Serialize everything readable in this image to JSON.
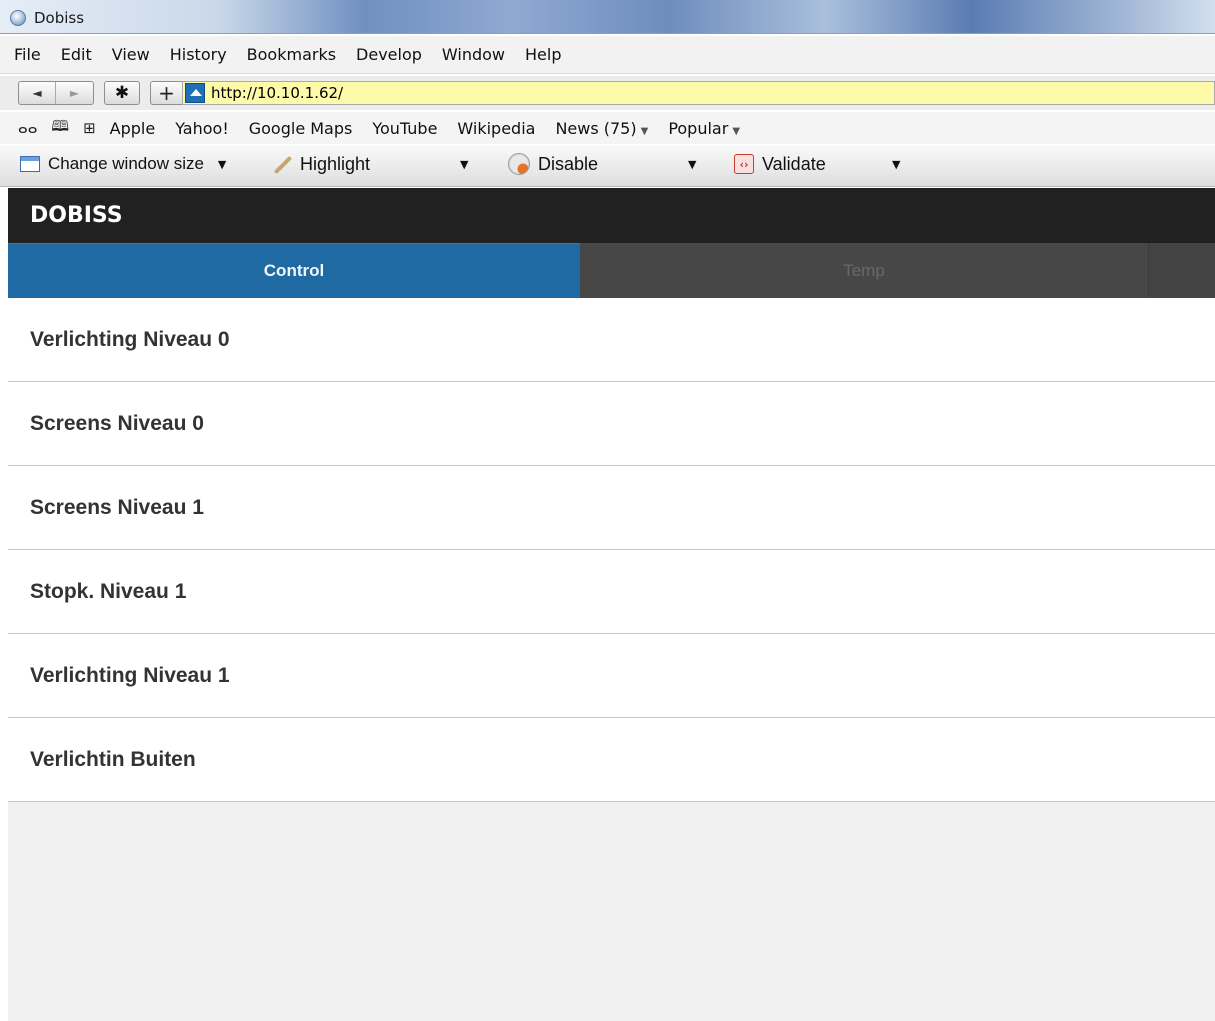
{
  "window": {
    "title": "Dobiss"
  },
  "menubar": {
    "items": [
      "File",
      "Edit",
      "View",
      "History",
      "Bookmarks",
      "Develop",
      "Window",
      "Help"
    ]
  },
  "nav": {
    "back_icon": "◄",
    "forward_icon": "►",
    "bug_icon": "✱",
    "add_icon": "+",
    "url": "http://10.10.1.62/"
  },
  "bookmarks": {
    "items": [
      "Apple",
      "Yahoo!",
      "Google Maps",
      "YouTube",
      "Wikipedia",
      "News (75)",
      "Popular"
    ],
    "reader_icon": "ⴰⴰ",
    "book_icon": "🕮",
    "grid_icon": "⊞"
  },
  "devtoolbar": {
    "window_size": "Change window size",
    "highlight": "Highlight",
    "disable": "Disable",
    "validate": "Validate",
    "caret": "▼"
  },
  "app": {
    "title": "DOBISS",
    "tabs": [
      {
        "label": "Control",
        "active": true
      },
      {
        "label": "Temp",
        "active": false
      }
    ],
    "items": [
      "Verlichting Niveau 0",
      "Screens Niveau 0",
      "Screens Niveau 1",
      "Stopk. Niveau 1",
      "Verlichting Niveau 1",
      "Verlichtin Buiten"
    ]
  },
  "colors": {
    "header_bg": "#212121",
    "tab_active": "#1f6aa3",
    "tab_inactive": "#474747",
    "address_bg": "#fdfba9",
    "page_empty_bg": "#f0f0f0"
  }
}
